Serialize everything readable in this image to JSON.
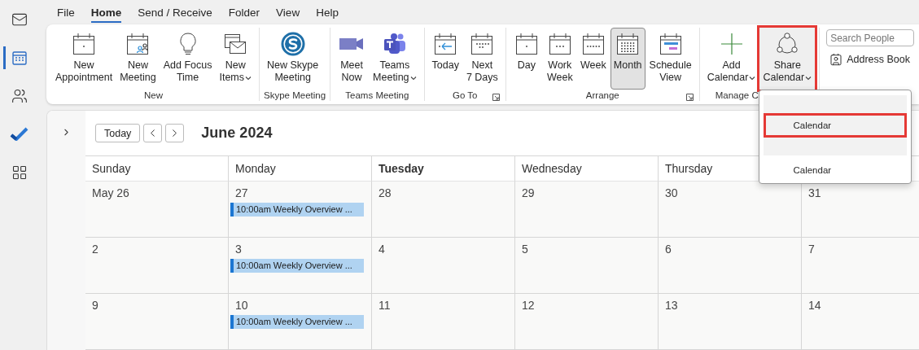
{
  "nav_rail": [
    {
      "kind": "mail",
      "selected": false
    },
    {
      "kind": "calendar",
      "selected": true
    },
    {
      "kind": "people",
      "selected": false
    },
    {
      "kind": "todo",
      "selected": false
    },
    {
      "kind": "apps",
      "selected": false
    }
  ],
  "menu_tabs": [
    {
      "label": "File",
      "selected": false
    },
    {
      "label": "Home",
      "selected": true
    },
    {
      "label": "Send / Receive",
      "selected": false
    },
    {
      "label": "Folder",
      "selected": false
    },
    {
      "label": "View",
      "selected": false
    },
    {
      "label": "Help",
      "selected": false
    }
  ],
  "ribbon": {
    "groups": [
      {
        "label": "New",
        "launcher": false,
        "buttons": [
          {
            "kind": "appointment",
            "lines": [
              "New",
              "Appointment"
            ],
            "dropdown": false,
            "selected": false,
            "highlighted": false,
            "expanded": false
          },
          {
            "kind": "meeting",
            "lines": [
              "New",
              "Meeting"
            ],
            "dropdown": false,
            "selected": false,
            "highlighted": false,
            "expanded": false
          },
          {
            "kind": "focus",
            "lines": [
              "Add Focus",
              "Time"
            ],
            "dropdown": false,
            "selected": false,
            "highlighted": false,
            "expanded": false
          },
          {
            "kind": "items",
            "lines": [
              "New",
              "Items"
            ],
            "dropdown": true,
            "selected": false,
            "highlighted": false,
            "expanded": false
          }
        ]
      },
      {
        "label": "Skype Meeting",
        "launcher": false,
        "buttons": [
          {
            "kind": "skype",
            "lines": [
              "New Skype",
              "Meeting"
            ],
            "dropdown": false,
            "selected": false,
            "highlighted": false,
            "expanded": false
          }
        ]
      },
      {
        "label": "Teams Meeting",
        "launcher": false,
        "buttons": [
          {
            "kind": "video",
            "lines": [
              "Meet",
              "Now"
            ],
            "dropdown": false,
            "selected": false,
            "highlighted": false,
            "expanded": false
          },
          {
            "kind": "teams",
            "lines": [
              "Teams",
              "Meeting"
            ],
            "dropdown": true,
            "selected": false,
            "highlighted": false,
            "expanded": false
          }
        ]
      },
      {
        "label": "Go To",
        "launcher": true,
        "buttons": [
          {
            "kind": "today",
            "lines": [
              "Today"
            ],
            "dropdown": false,
            "selected": false,
            "highlighted": false,
            "expanded": false
          },
          {
            "kind": "next",
            "lines": [
              "Next",
              "7 Days"
            ],
            "dropdown": false,
            "selected": false,
            "highlighted": false,
            "expanded": false
          }
        ]
      },
      {
        "label": "Arrange",
        "launcher": true,
        "buttons": [
          {
            "kind": "day",
            "lines": [
              "Day"
            ],
            "dropdown": false,
            "selected": false,
            "highlighted": false,
            "expanded": false
          },
          {
            "kind": "workweek",
            "lines": [
              "Work",
              "Week"
            ],
            "dropdown": false,
            "selected": false,
            "highlighted": false,
            "expanded": false
          },
          {
            "kind": "week",
            "lines": [
              "Week"
            ],
            "dropdown": false,
            "selected": false,
            "highlighted": false,
            "expanded": false
          },
          {
            "kind": "month",
            "lines": [
              "Month"
            ],
            "dropdown": false,
            "selected": true,
            "highlighted": false,
            "expanded": false
          },
          {
            "kind": "schedule",
            "lines": [
              "Schedule",
              "View"
            ],
            "dropdown": false,
            "selected": false,
            "highlighted": false,
            "expanded": false
          }
        ]
      },
      {
        "label": "Manage C",
        "launcher": false,
        "buttons": [
          {
            "kind": "add",
            "lines": [
              "Add",
              "Calendar"
            ],
            "dropdown": true,
            "selected": false,
            "highlighted": false,
            "expanded": false
          },
          {
            "kind": "share",
            "lines": [
              "Share",
              "Calendar"
            ],
            "dropdown": true,
            "selected": false,
            "highlighted": true,
            "expanded": true
          }
        ]
      }
    ],
    "search": {
      "placeholder": "Search People"
    },
    "address_book": "Address Book"
  },
  "share_menu": [
    {
      "label": "Calendar",
      "selected": true
    },
    {
      "label": "Calendar",
      "selected": false
    }
  ],
  "calendar": {
    "today_button": "Today",
    "title": "June 2024",
    "day_headers": [
      {
        "label": "Sunday",
        "today": false
      },
      {
        "label": "Monday",
        "today": false
      },
      {
        "label": "Tuesday",
        "today": true
      },
      {
        "label": "Wednesday",
        "today": false
      },
      {
        "label": "Thursday",
        "today": false
      }
    ],
    "weeks": [
      {
        "days": [
          {
            "date": "May 26"
          },
          {
            "date": "27",
            "events": [
              "10:00am Weekly Overview ..."
            ]
          },
          {
            "date": "28"
          },
          {
            "date": "29"
          },
          {
            "date": "30"
          },
          {
            "date": "31"
          }
        ]
      },
      {
        "days": [
          {
            "date": "2"
          },
          {
            "date": "3",
            "events": [
              "10:00am Weekly Overview ..."
            ]
          },
          {
            "date": "4"
          },
          {
            "date": "5"
          },
          {
            "date": "6"
          },
          {
            "date": "7"
          }
        ]
      },
      {
        "days": [
          {
            "date": "9"
          },
          {
            "date": "10",
            "events": [
              "10:00am Weekly Overview ..."
            ]
          },
          {
            "date": "11"
          },
          {
            "date": "12"
          },
          {
            "date": "13"
          },
          {
            "date": "14"
          }
        ]
      }
    ]
  }
}
